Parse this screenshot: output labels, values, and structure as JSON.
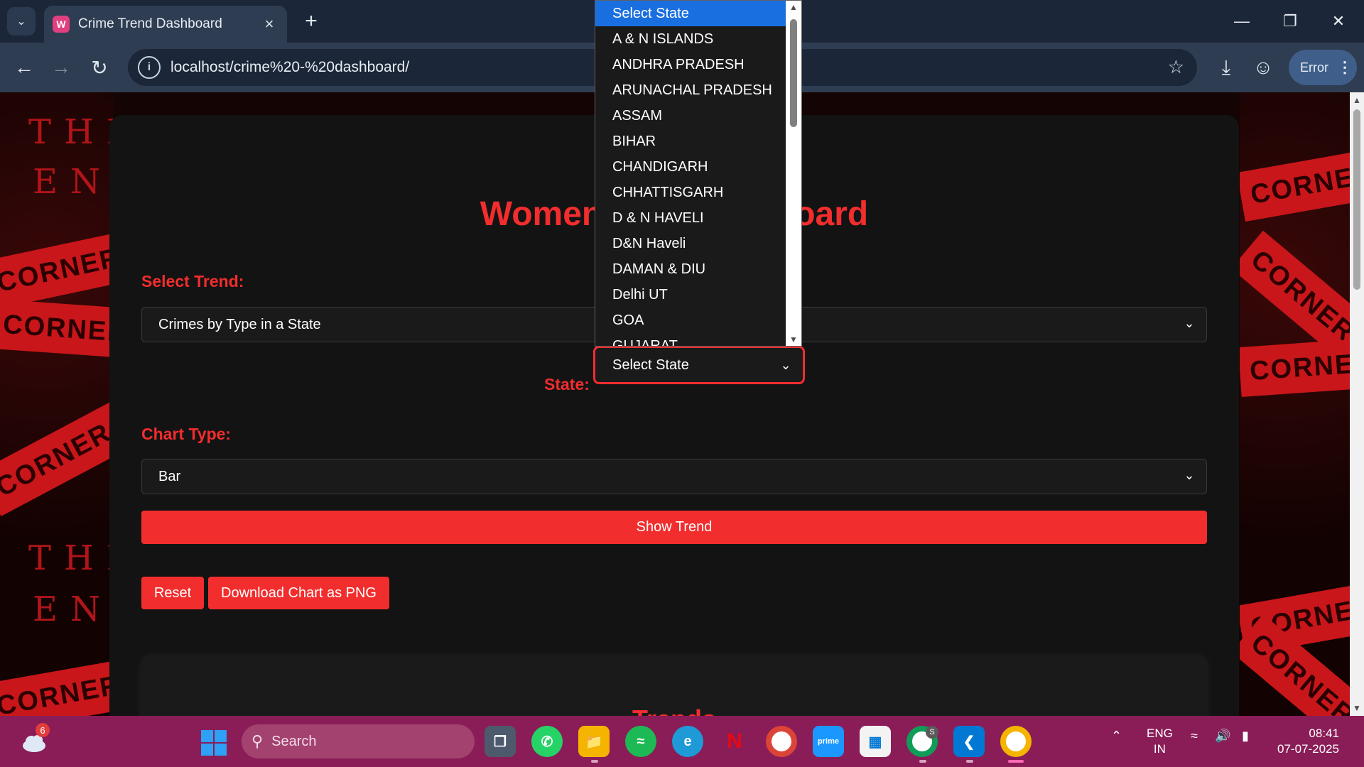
{
  "browser": {
    "tab_title": "Crime Trend Dashboard",
    "url": "localhost/crime%20-%20dashboard/",
    "profile_status": "Error"
  },
  "page": {
    "title_left": "Women",
    "title_right": "oard",
    "select_trend_label": "Select Trend:",
    "selected_trend": "Crimes by Type in a State",
    "state_label": "State:",
    "selected_state": "Select State",
    "chart_type_label": "Chart Type:",
    "selected_chart_type": "Bar",
    "show_trend_button": "Show Trend",
    "reset_button": "Reset",
    "download_button": "Download Chart as PNG",
    "trends_heading": "Trends",
    "background_words": {
      "corner": "CORNER",
      "the": "THE",
      "end": "END"
    }
  },
  "state_dropdown": {
    "options": [
      "Select State",
      "A & N ISLANDS",
      "ANDHRA PRADESH",
      "ARUNACHAL PRADESH",
      "ASSAM",
      "BIHAR",
      "CHANDIGARH",
      "CHHATTISGARH",
      "D & N HAVELI",
      "D&N Haveli",
      "DAMAN & DIU",
      "Delhi UT",
      "GOA",
      "GUJARAT"
    ],
    "selected_index": 0
  },
  "taskbar": {
    "search_placeholder": "Search",
    "notification_count": "6",
    "language": "ENG",
    "region": "IN",
    "time": "08:41",
    "date": "07-07-2025",
    "chrome_badge": "S"
  },
  "colors": {
    "accent_red": "#f22d2d",
    "selected_blue": "#1a6fe0",
    "taskbar": "#8a1d57"
  }
}
